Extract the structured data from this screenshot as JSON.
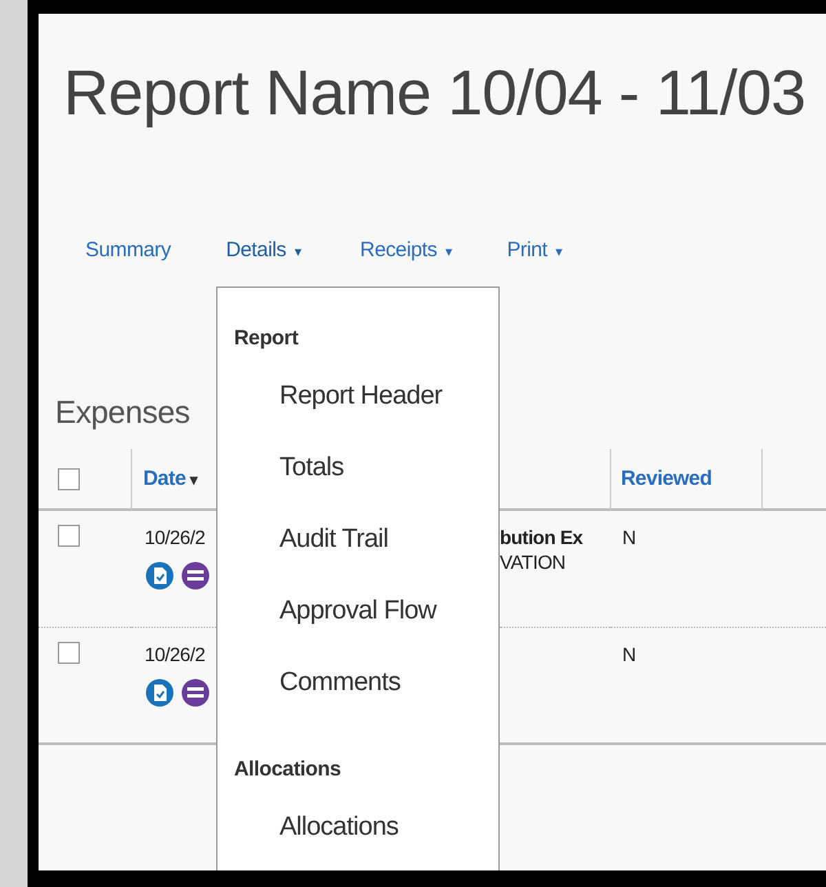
{
  "title": "Report Name 10/04 - 11/03",
  "tabs": [
    {
      "label": "Summary",
      "open": false
    },
    {
      "label": "Details",
      "caret": "▾",
      "open": true
    },
    {
      "label": "Receipts",
      "caret": "▾",
      "open": false
    },
    {
      "label": "Print",
      "caret": "▾",
      "open": false
    }
  ],
  "dropdown": {
    "sections": [
      {
        "heading": "Report",
        "items": [
          "Report Header",
          "Totals",
          "Audit Trail",
          "Approval Flow",
          "Comments"
        ]
      },
      {
        "heading": "Allocations",
        "items": [
          "Allocations"
        ]
      }
    ]
  },
  "expenses": {
    "heading": "Expenses",
    "columns": [
      {
        "label": "Date",
        "sort": "▾"
      },
      {
        "label": "Reviewed"
      }
    ],
    "select_all_checked": false,
    "rows": [
      {
        "checked": false,
        "date": "10/26/2",
        "type": "bution Ex",
        "detail": "VATION",
        "reviewed": "N"
      },
      {
        "checked": false,
        "date": "10/26/2",
        "type": null,
        "detail": null,
        "reviewed": "N"
      }
    ]
  }
}
